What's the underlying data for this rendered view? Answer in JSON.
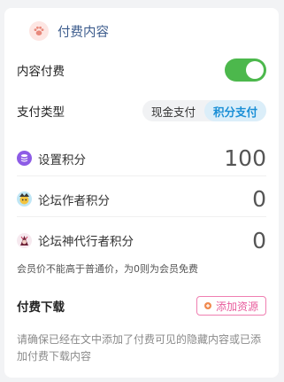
{
  "header": {
    "icon": "paw-icon",
    "title": "付费内容"
  },
  "pay_toggle": {
    "label": "内容付费",
    "enabled": true,
    "color": "#4cb84c"
  },
  "pay_type": {
    "label": "支付类型",
    "options": [
      "现金支付",
      "积分支付"
    ],
    "selected": "积分支付",
    "accent": "#1a8fd6"
  },
  "points": [
    {
      "icon": "database-icon",
      "label": "设置积分",
      "value": "100"
    },
    {
      "icon": "author-avatar-icon",
      "label": "论坛作者积分",
      "value": "0"
    },
    {
      "icon": "moderator-avatar-icon",
      "label": "论坛神代行者积分",
      "value": "0"
    }
  ],
  "member_note": "会员价不能高于普通价，为0则为会员免费",
  "download": {
    "title": "付费下载",
    "add_button": "添加资源",
    "accent": "#e85d9d"
  },
  "hint": "请确保已经在文中添加了付费可见的隐藏内容或已添加付费下载内容"
}
